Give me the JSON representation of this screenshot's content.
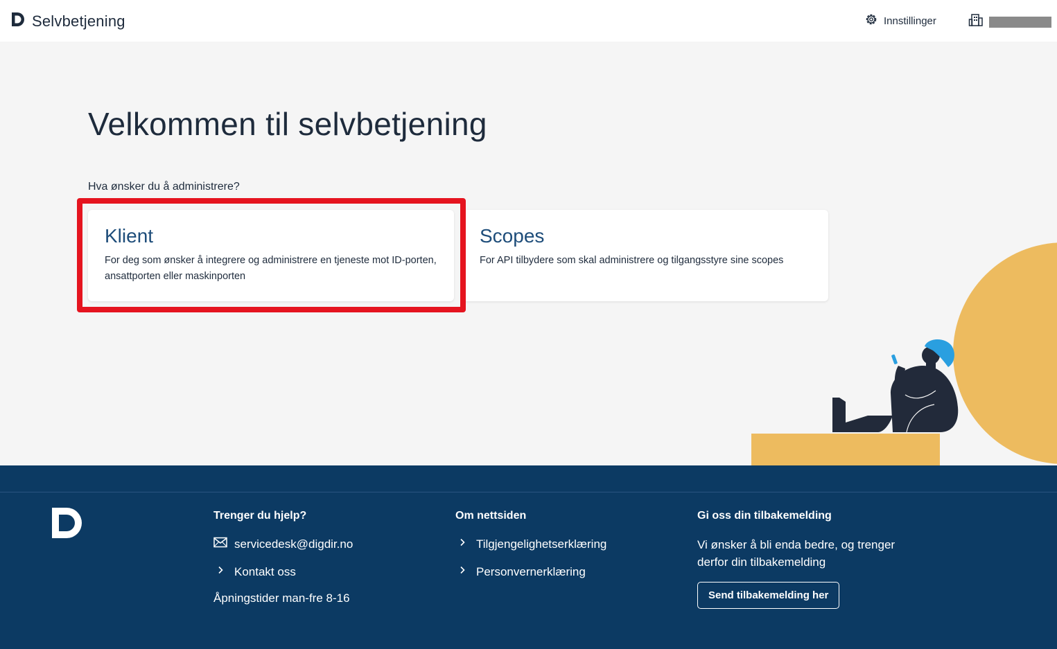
{
  "header": {
    "brand_title": "Selvbetjening",
    "settings_label": "Innstillinger",
    "icons": [
      "digdir-logo-icon",
      "gear-icon",
      "building-icon"
    ]
  },
  "main": {
    "title": "Velkommen til selvbetjening",
    "question": "Hva ønsker du å administrere?",
    "cards": [
      {
        "title": "Klient",
        "description": "For deg som ønsker å integrere og administrere en tjeneste mot ID-porten, ansattporten eller maskinporten"
      },
      {
        "title": "Scopes",
        "description": "For API tilbydere som skal administrere og tilgangsstyre sine scopes"
      }
    ],
    "highlight_color": "#e5141f"
  },
  "footer": {
    "help": {
      "title": "Trenger du hjelp?",
      "email": "servicedesk@digdir.no",
      "contact": "Kontakt oss",
      "hours": "Åpningstider man-fre 8-16"
    },
    "about": {
      "title": "Om nettsiden",
      "links": [
        "Tilgjengelighetserklæring",
        "Personvernerklæring"
      ]
    },
    "feedback": {
      "title": "Gi oss din tilbakemelding",
      "text": "Vi ønsker å bli enda bedre, og trenger derfor din tilbakemelding",
      "button": "Send tilbakemelding her"
    }
  },
  "colors": {
    "footer_bg": "#0c3a63",
    "card_title": "#1e4d7a",
    "accent_yellow": "#edbb5f",
    "accent_blue": "#2a9fe0"
  }
}
